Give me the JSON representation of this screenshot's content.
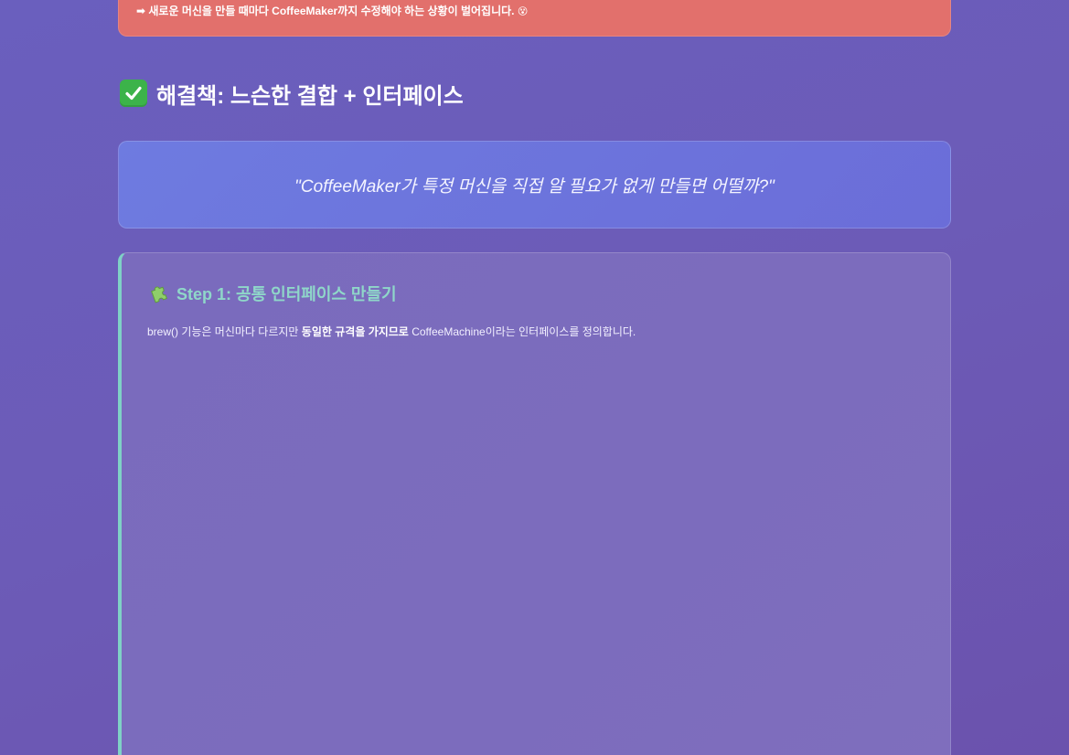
{
  "problem": {
    "text": "➡ 새로운 머신을 만들 때마다 CoffeeMaker까지 수정해야 하는 상황이 벌어집니다.",
    "emoji": "😵"
  },
  "solution": {
    "heading": "해결책: 느슨한 결합 + 인터페이스",
    "heading_icon": "check-icon"
  },
  "quote": {
    "text": "\"CoffeeMaker가 특정 머신을 직접 알 필요가 없게 만들면 어떨까?\""
  },
  "step1": {
    "icon": "puzzle-icon",
    "title": "Step 1: 공통 인터페이스 만들기",
    "desc_before": "brew() 기능은 머신마다 다르지만 ",
    "desc_bold": "동일한 규격을 가지므로",
    "desc_after": " CoffeeMachine이라는 인터페이스를 정의합니다."
  },
  "colors": {
    "background": "#6b5ab6",
    "problem_box": "#e2706c",
    "quote_box": "#6e75dc",
    "step_card": "#7b6bbd",
    "accent_teal": "#8fd7c9",
    "check_green": "#3cb34a"
  }
}
